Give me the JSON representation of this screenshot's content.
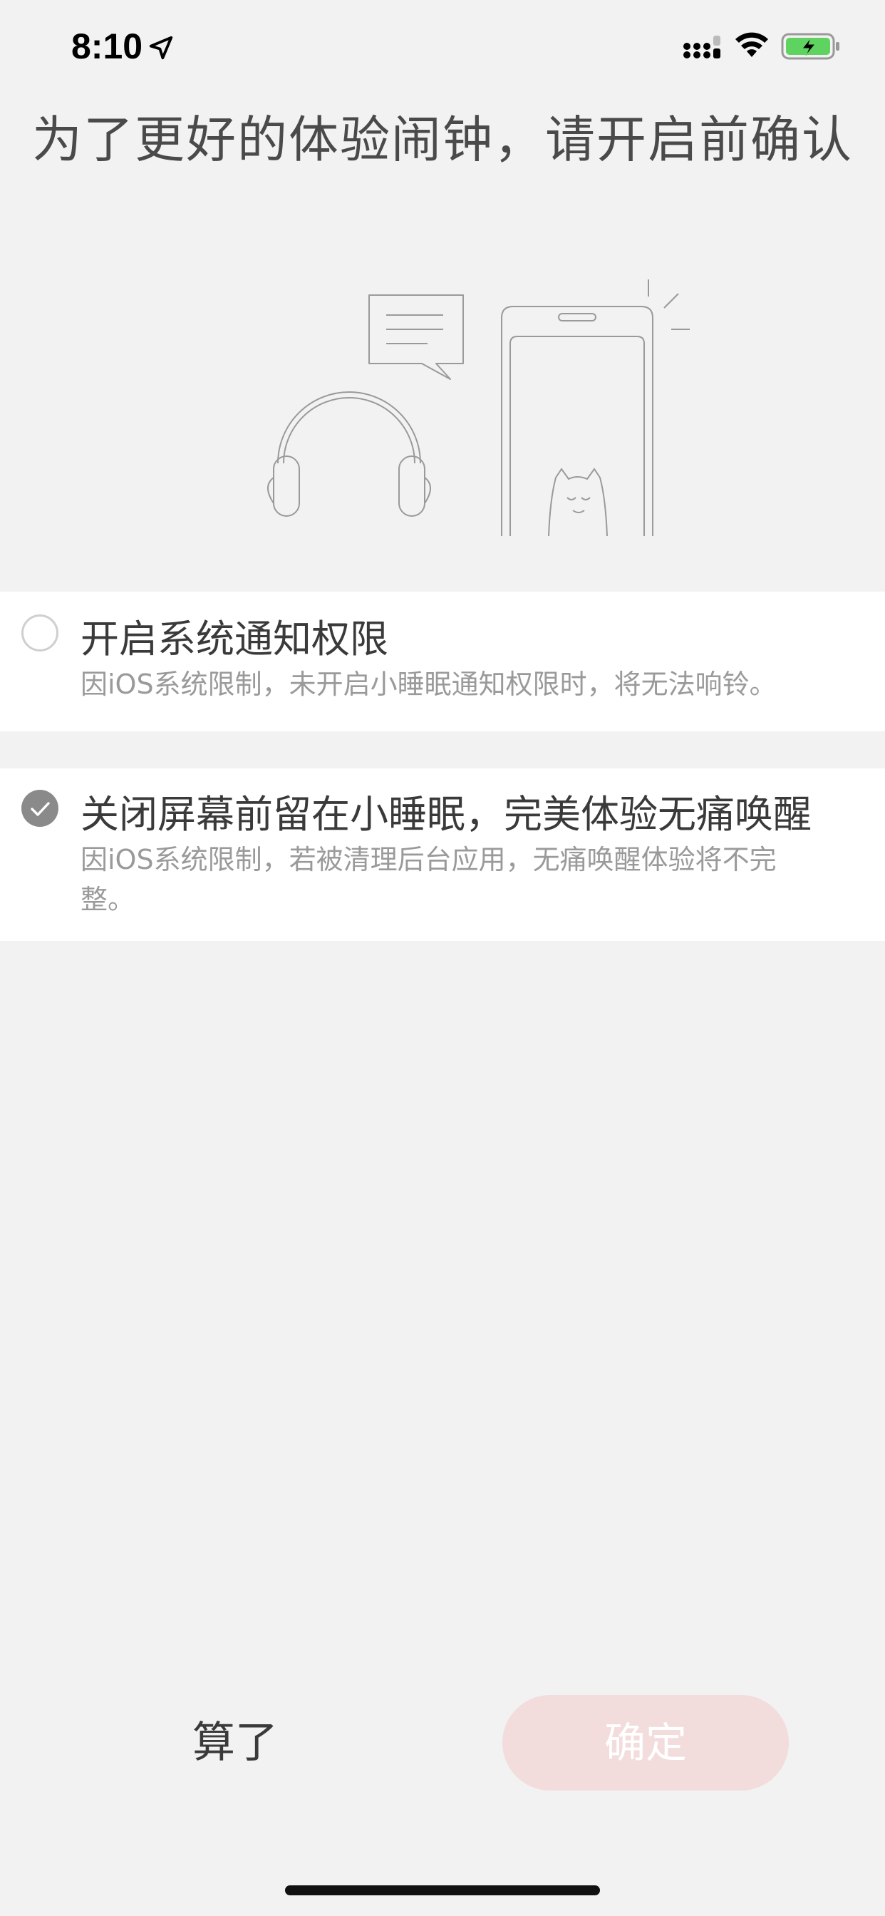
{
  "status_bar": {
    "time": "8:10",
    "icons": [
      "location-arrow-icon",
      "cellular-signal-icon",
      "wifi-icon",
      "battery-charging-icon"
    ],
    "battery_color": "#5fd35f"
  },
  "heading": "为了更好的体验闹钟，请开启前确认",
  "options": [
    {
      "title": "开启系统通知权限",
      "description": "因iOS系统限制，未开启小睡眠通知权限时，将无法响铃。",
      "checked": false
    },
    {
      "title": "关闭屏幕前留在小睡眠，完美体验无痛唤醒",
      "description": "因iOS系统限制，若被清理后台应用，无痛唤醒体验将不完整。",
      "checked": true
    }
  ],
  "actions": {
    "cancel_label": "算了",
    "confirm_label": "确定",
    "confirm_color": "#f3dcdc"
  }
}
